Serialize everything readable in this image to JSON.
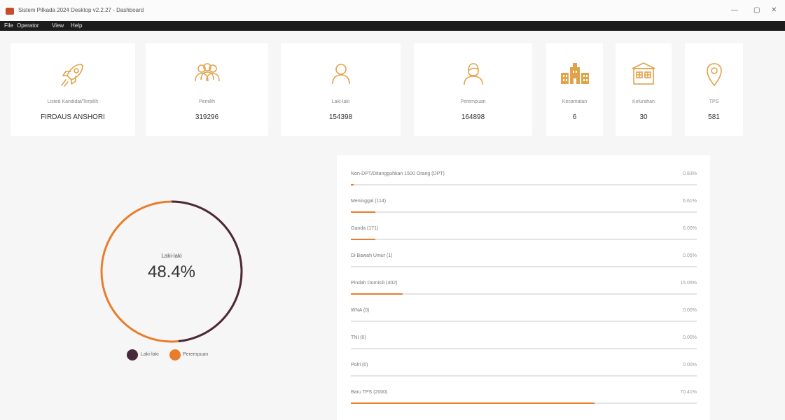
{
  "window": {
    "title": "Sistem Pilkada 2024 Desktop v2.2.27 - Dashboard",
    "minimize": "—",
    "maximize": "▢",
    "close": "✕"
  },
  "menu": [
    "File",
    "Operator",
    "View",
    "Help"
  ],
  "cards": [
    {
      "icon": "rocket-icon",
      "label": "Listed Kandidat/Terpilih",
      "value": "FIRDAUS ANSHORI"
    },
    {
      "icon": "people-group-icon",
      "label": "Pemilih",
      "value": "319296"
    },
    {
      "icon": "male-user-icon",
      "label": "Laki-laki",
      "value": "154398"
    },
    {
      "icon": "female-user-icon",
      "label": "Perempuan",
      "value": "164898"
    },
    {
      "icon": "buildings-icon",
      "label": "Kecamatan",
      "value": "6"
    },
    {
      "icon": "village-icon",
      "label": "Kelurahan",
      "value": "30"
    },
    {
      "icon": "location-pin-icon",
      "label": "TPS",
      "value": "581"
    }
  ],
  "donut": {
    "label": "Laki-laki",
    "percent_text": "48.4%",
    "fraction": 0.484
  },
  "legend": [
    {
      "name": "Laki-laki",
      "color": "#4a2a3a"
    },
    {
      "name": "Perempuan",
      "color": "#e97d2c"
    }
  ],
  "progress": [
    {
      "label": "Non-DPT/Ditangguhkan 1500 Orang (DPT)",
      "value": "0.83%",
      "pct": 0.8
    },
    {
      "label": "Meninggal (114)",
      "value": "6.61%",
      "pct": 7.0
    },
    {
      "label": "Ganda (171)",
      "value": "6.00%",
      "pct": 7.0
    },
    {
      "label": "Di Bawah Umur (1)",
      "value": "0.05%",
      "pct": 0
    },
    {
      "label": "Pindah Domisili (402)",
      "value": "15.05%",
      "pct": 15.0
    },
    {
      "label": "WNA (0)",
      "value": "0.00%",
      "pct": 0
    },
    {
      "label": "TNI (0)",
      "value": "0.00%",
      "pct": 0
    },
    {
      "label": "Polri (0)",
      "value": "0.00%",
      "pct": 0
    },
    {
      "label": "Baru TPS (2000)",
      "value": "70.41%",
      "pct": 70.4
    }
  ],
  "colors": {
    "accent": "#e97d2c",
    "dark": "#4a2a3a",
    "icon": "#e1a24a"
  }
}
